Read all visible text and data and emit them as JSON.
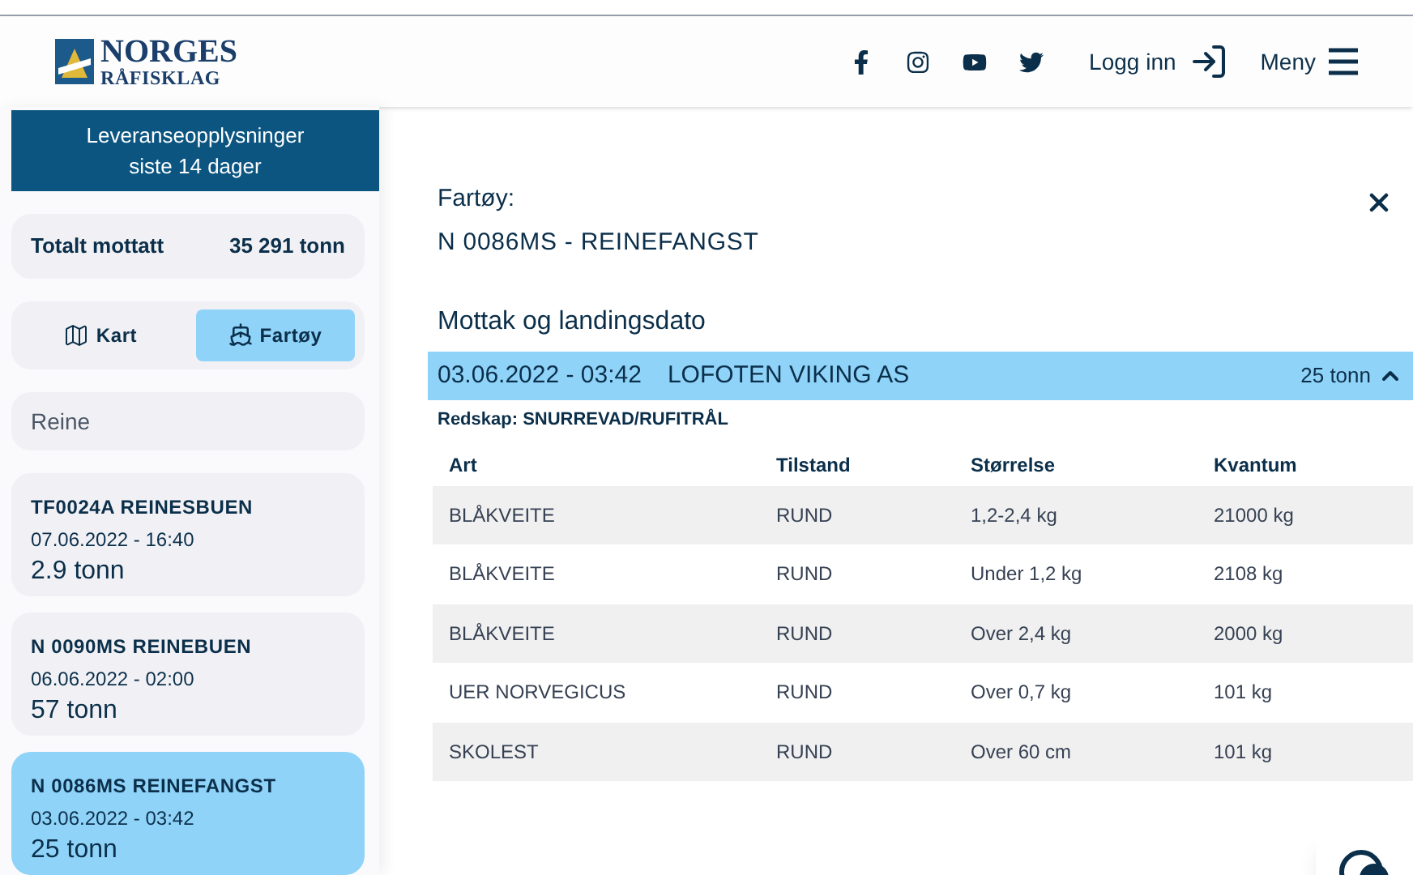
{
  "header": {
    "logo": {
      "line1": "NORGES",
      "line2": "RÅFISKLAG"
    },
    "social": [
      {
        "kind": "facebook"
      },
      {
        "kind": "instagram"
      },
      {
        "kind": "youtube"
      },
      {
        "kind": "twitter"
      }
    ],
    "login": "Logg inn",
    "menu": "Meny"
  },
  "sidebar": {
    "title": "Leveranseopplysninger",
    "subtitle": "siste 14 dager",
    "total": {
      "label": "Totalt mottatt",
      "value": "35 291 tonn"
    },
    "toggle": [
      {
        "label": "Kart",
        "kind": "map",
        "selected": false
      },
      {
        "label": "Fartøy",
        "kind": "vessel",
        "selected": true
      }
    ],
    "search": {
      "value": "Reine"
    },
    "vessels": [
      {
        "name": "TF0024A REINESBUEN",
        "date": "07.06.2022 - 16:40",
        "amount": "2.9 tonn",
        "selected": false
      },
      {
        "name": "N 0090MS REINEBUEN",
        "date": "06.06.2022 - 02:00",
        "amount": "57 tonn",
        "selected": false
      },
      {
        "name": "N 0086MS REINEFANGST",
        "date": "03.06.2022 - 03:42",
        "amount": "25 tonn",
        "selected": true
      }
    ]
  },
  "detail": {
    "label": "Fartøy:",
    "vessel": "N 0086MS - REINEFANGST",
    "section": "Mottak og landingsdato",
    "landing": {
      "date": "03.06.2022 - 03:42",
      "buyer": "LOFOTEN VIKING AS",
      "amount": "25 tonn",
      "expanded": true
    },
    "gear": "Redskap: SNURREVAD/RUFITRÅL",
    "table": {
      "columns": [
        "Art",
        "Tilstand",
        "Størrelse",
        "Kvantum"
      ],
      "rows": [
        [
          "BLÅKVEITE",
          "RUND",
          "1,2-2,4 kg",
          "21000 kg"
        ],
        [
          "BLÅKVEITE",
          "RUND",
          "Under 1,2 kg",
          "2108 kg"
        ],
        [
          "BLÅKVEITE",
          "RUND",
          "Over 2,4 kg",
          "2000 kg"
        ],
        [
          "UER NORVEGICUS",
          "RUND",
          "Over 0,7 kg",
          "101 kg"
        ],
        [
          "SKOLEST",
          "RUND",
          "Over 60 cm",
          "101 kg"
        ]
      ]
    }
  }
}
